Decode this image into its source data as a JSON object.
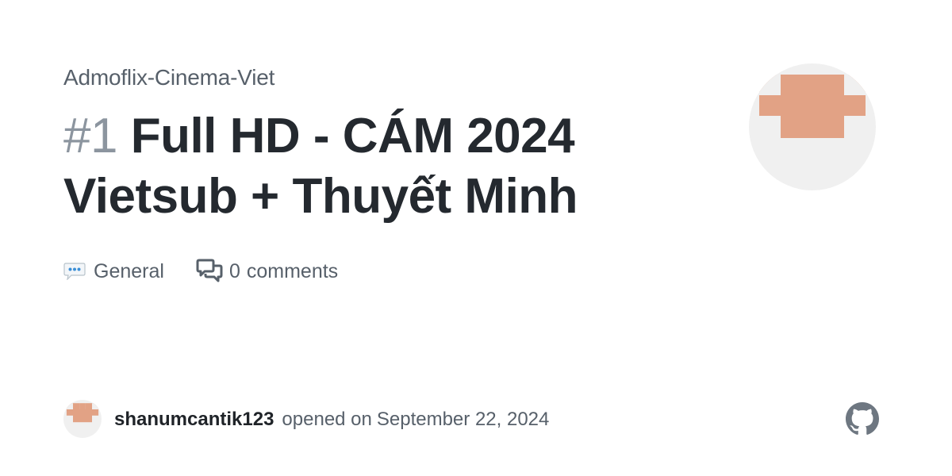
{
  "repo": {
    "name": "Admoflix-Cinema-Viet"
  },
  "discussion": {
    "number": "#1",
    "title": "Full HD - CÁM 2024 Vietsub + Thuyết Minh",
    "category_icon": "speech-balloon-icon",
    "category": "General",
    "comment_icon": "comment-discussion-icon",
    "comments_count": "0",
    "comments_label": "comments"
  },
  "author": {
    "username": "shanumcantik123",
    "opened_text": "opened on",
    "date": "September 22, 2024",
    "avatar_color": "#e2a285",
    "avatar_bg": "#f0f0f0"
  },
  "brand": {
    "icon": "github-logo-icon",
    "color": "#6e7781"
  }
}
